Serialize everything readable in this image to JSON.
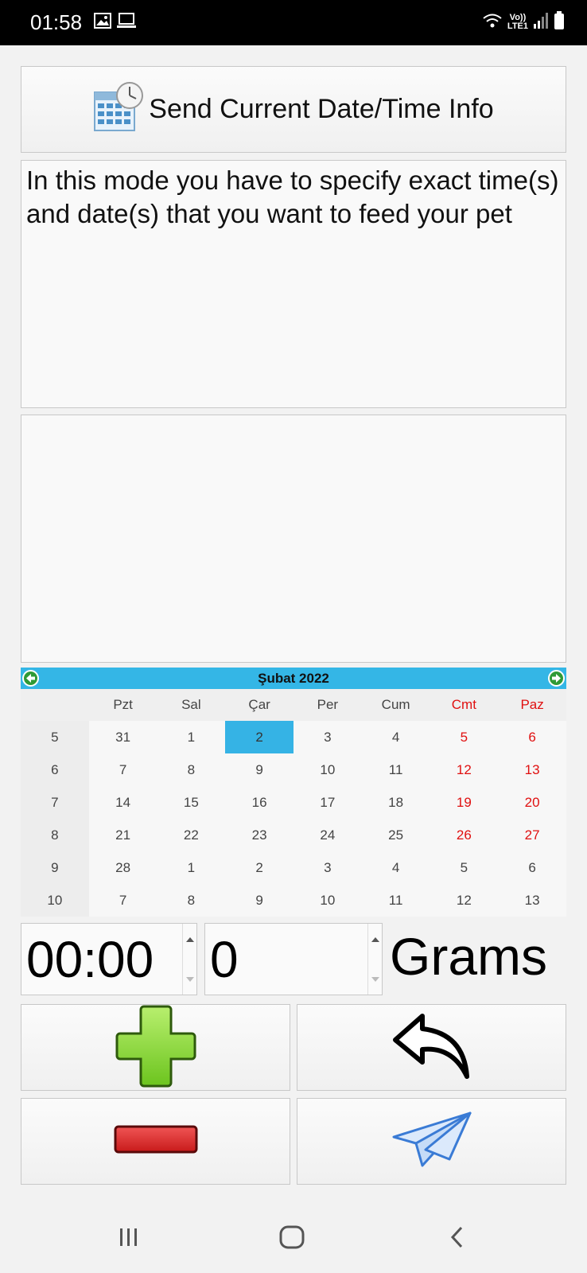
{
  "status_bar": {
    "time": "01:58",
    "network_top": "Vo))",
    "network_bottom": "LTE1",
    "icons": [
      "image-icon",
      "laptop-icon",
      "wifi-icon",
      "signal-icon",
      "battery-icon"
    ]
  },
  "send_time_button": {
    "label": "Send Current Date/Time Info",
    "icon": "calendar-clock-icon"
  },
  "info": {
    "text": "In this mode you have to specify exact time(s) and date(s) that you want to feed your pet"
  },
  "calendar": {
    "title": "Şubat  2022",
    "days_of_week": [
      "Pzt",
      "Sal",
      "Çar",
      "Per",
      "Cum",
      "Cmt",
      "Paz"
    ],
    "weeks": [
      {
        "week": "5",
        "days": [
          "31",
          "1",
          "2",
          "3",
          "4",
          "5",
          "6"
        ]
      },
      {
        "week": "6",
        "days": [
          "7",
          "8",
          "9",
          "10",
          "11",
          "12",
          "13"
        ]
      },
      {
        "week": "7",
        "days": [
          "14",
          "15",
          "16",
          "17",
          "18",
          "19",
          "20"
        ]
      },
      {
        "week": "8",
        "days": [
          "21",
          "22",
          "23",
          "24",
          "25",
          "26",
          "27"
        ]
      },
      {
        "week": "9",
        "days": [
          "28",
          "1",
          "2",
          "3",
          "4",
          "5",
          "6"
        ]
      },
      {
        "week": "10",
        "days": [
          "7",
          "8",
          "9",
          "10",
          "11",
          "12",
          "13"
        ]
      }
    ],
    "selected": "2",
    "header_color": "#34b6e6",
    "weekend_color": "#e01010"
  },
  "time_spinner": {
    "value": "00:00"
  },
  "grams_spinner": {
    "value": "0"
  },
  "grams_label": "Grams",
  "actions": {
    "add": "plus-icon",
    "undo": "undo-arrow-icon",
    "remove": "minus-icon",
    "send": "paper-plane-icon"
  },
  "nav": [
    "recent-apps-icon",
    "home-icon",
    "back-icon"
  ]
}
